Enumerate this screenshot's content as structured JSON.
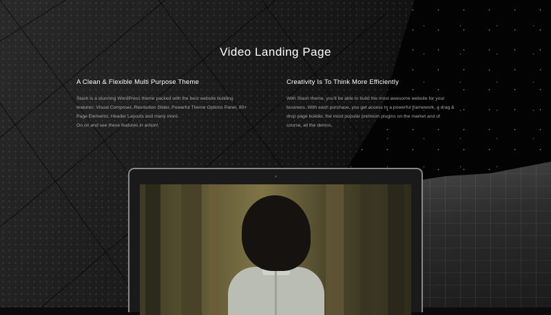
{
  "page": {
    "title": "Video Landing Page"
  },
  "features": [
    {
      "heading": "A Clean & Flexible Multi Purpose Theme",
      "body_lines": [
        "Stash is a stunning WordPress theme packed with the best website building",
        "features: Visual Composer, Revolution Slider, Powerful Theme Options Panel, 80+",
        "Page Elements, Header Layouts and many more.",
        "Go on and see these features in action!"
      ]
    },
    {
      "heading": "Creativity  Is To Think More Efficiently",
      "body_lines": [
        "With Stash theme, you'll be able to build the most awesome website for your",
        "business. With each purchase, you get access to a powerful framework, a drag &",
        "drop page builder, the most popular premium plugins on the market and of",
        "course, all the demos."
      ]
    }
  ],
  "colors": {
    "background": "#0b0b0b",
    "heading": "#ffffff",
    "body_text": "#a9a9a9",
    "laptop_bezel": "#8a8a8a"
  },
  "icons": [
    "laptop-mockup",
    "video-preview"
  ]
}
